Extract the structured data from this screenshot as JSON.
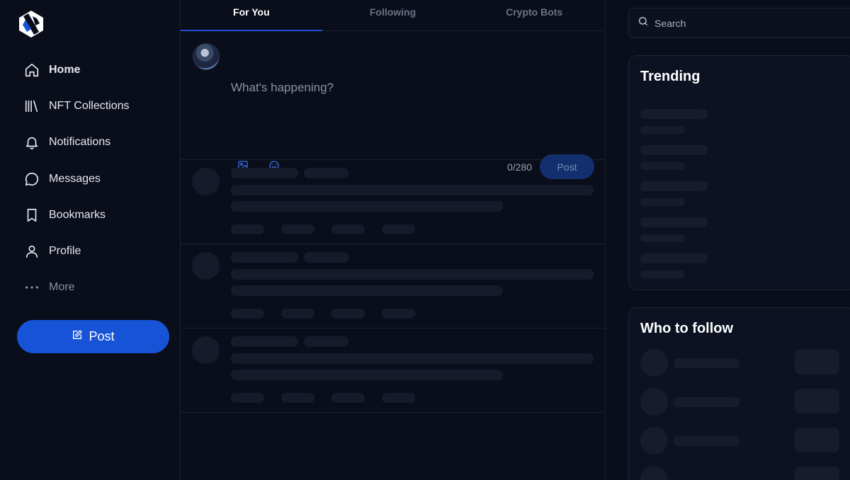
{
  "brand": {
    "logo_icon": "logo-icon",
    "accent": "#1753d6"
  },
  "sidebar": {
    "items": [
      {
        "label": "Home",
        "icon": "home-icon",
        "active": true
      },
      {
        "label": "NFT Collections",
        "icon": "library-icon"
      },
      {
        "label": "Notifications",
        "icon": "bell-icon"
      },
      {
        "label": "Messages",
        "icon": "message-icon"
      },
      {
        "label": "Bookmarks",
        "icon": "bookmark-icon"
      },
      {
        "label": "Profile",
        "icon": "user-icon"
      },
      {
        "label": "More",
        "icon": "more-icon"
      }
    ],
    "post_label": "Post"
  },
  "main": {
    "tabs": [
      {
        "label": "For You",
        "active": true
      },
      {
        "label": "Following"
      },
      {
        "label": "Crypto Bots"
      }
    ],
    "composer": {
      "placeholder": "What's happening?",
      "counter": "0/280",
      "post_label": "Post"
    }
  },
  "right": {
    "search_placeholder": "Search",
    "trending_title": "Trending",
    "follow_title": "Who to follow"
  }
}
